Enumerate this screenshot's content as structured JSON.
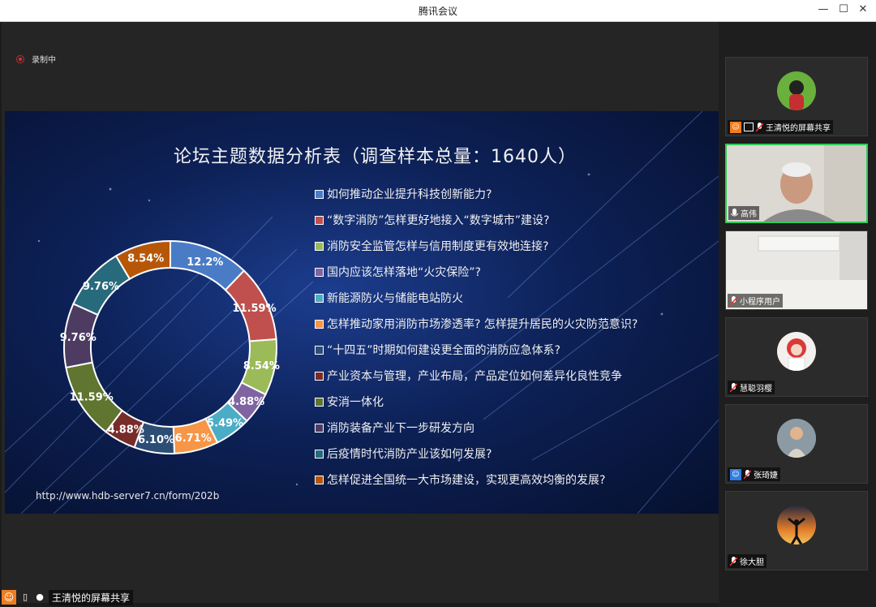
{
  "window": {
    "title": "腾讯会议"
  },
  "recording": {
    "label": "录制中"
  },
  "slide": {
    "title": "论坛主题数据分析表（调查样本总量：1640人）",
    "url": "http://www.hdb-server7.cn/form/202b",
    "legend": [
      "如何推动企业提升科技创新能力?",
      "“数字消防”怎样更好地接入“数字城市”建设?",
      "消防安全监管怎样与信用制度更有效地连接?",
      "国内应该怎样落地“火灾保险”?",
      "新能源防火与储能电站防火",
      "怎样推动家用消防市场渗透率? 怎样提升居民的火灾防范意识?",
      "“十四五”时期如何建设更全面的消防应急体系?",
      "产业资本与管理，产业布局，产品定位如何差异化良性竞争",
      "安消一体化",
      "消防装备产业下一步研发方向",
      "后疫情时代消防产业该如何发展?",
      "怎样促进全国统一大市场建设，实现更高效均衡的发展?"
    ]
  },
  "chart_data": {
    "type": "pie",
    "donut": true,
    "categories": [
      "如何推动企业提升科技创新能力?",
      "“数字消防”怎样更好地接入“数字城市”建设?",
      "消防安全监管怎样与信用制度更有效地连接?",
      "国内应该怎样落地“火灾保险”?",
      "新能源防火与储能电站防火",
      "怎样推动家用消防市场渗透率? 怎样提升居民的火灾防范意识?",
      "“十四五”时期如何建设更全面的消防应急体系?",
      "产业资本与管理，产业布局，产品定位如何差异化良性竞争",
      "安消一体化",
      "消防装备产业下一步研发方向",
      "后疫情时代消防产业该如何发展?",
      "怎样促进全国统一大市场建设，实现更高效均衡的发展?"
    ],
    "values": [
      12.2,
      11.59,
      8.54,
      4.88,
      5.49,
      6.71,
      6.1,
      4.88,
      11.59,
      9.76,
      9.76,
      8.54
    ],
    "labels": [
      "12.2%",
      "11.59%",
      "8.54%",
      "4.88%",
      "5.49%",
      "6.71%",
      "6.10%",
      "4.88%",
      "11.59%",
      "9.76%",
      "9.76%",
      "8.54%"
    ],
    "colors": [
      "#4a7cc6",
      "#c0504d",
      "#9bbb59",
      "#8064a2",
      "#4bacc6",
      "#f79646",
      "#2c4d75",
      "#772c2a",
      "#5f7530",
      "#4d3b62",
      "#276a7c",
      "#b65708"
    ]
  },
  "bottom_bar": {
    "label": "王清悦的屏幕共享"
  },
  "participants": [
    {
      "name": "王清悦的屏幕共享"
    },
    {
      "name": "高伟"
    },
    {
      "name": "小程序用户"
    },
    {
      "name": "慧聪羽樱"
    },
    {
      "name": "张琦婕"
    },
    {
      "name": "徐大胆"
    }
  ]
}
